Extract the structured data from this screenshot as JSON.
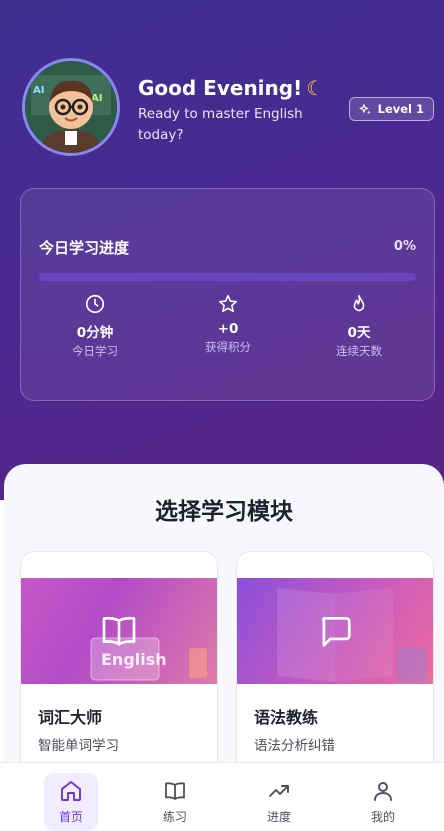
{
  "colors": {
    "accent": "#6d35d8",
    "hero_start": "#3d2f8f",
    "hero_end": "#5b2388",
    "moon": "#ffd23d"
  },
  "header": {
    "greeting": "Good Evening!",
    "greeting_icon": "moon-icon",
    "subtitle": "Ready to master English today?",
    "level_badge": "Level 1"
  },
  "progress": {
    "title": "今日学习进度",
    "percent_text": "0%",
    "percent_value": 0,
    "stats": [
      {
        "icon": "clock-icon",
        "value": "0分钟",
        "label": "今日学习"
      },
      {
        "icon": "star-icon",
        "value": "+0",
        "label": "获得积分"
      },
      {
        "icon": "flame-icon",
        "value": "0天",
        "label": "连续天数"
      }
    ]
  },
  "modules": {
    "title": "选择学习模块",
    "items": [
      {
        "name": "词汇大师",
        "desc": "智能单词学习",
        "icon": "book-icon",
        "banner_text": "English"
      },
      {
        "name": "语法教练",
        "desc": "语法分析纠错",
        "icon": "chat-bubble-icon"
      }
    ]
  },
  "tabbar": {
    "tabs": [
      {
        "label": "首页",
        "icon": "home-icon",
        "active": true
      },
      {
        "label": "练习",
        "icon": "open-book-icon"
      },
      {
        "label": "进度",
        "icon": "trending-up-icon"
      },
      {
        "label": "我的",
        "icon": "user-icon"
      }
    ]
  }
}
